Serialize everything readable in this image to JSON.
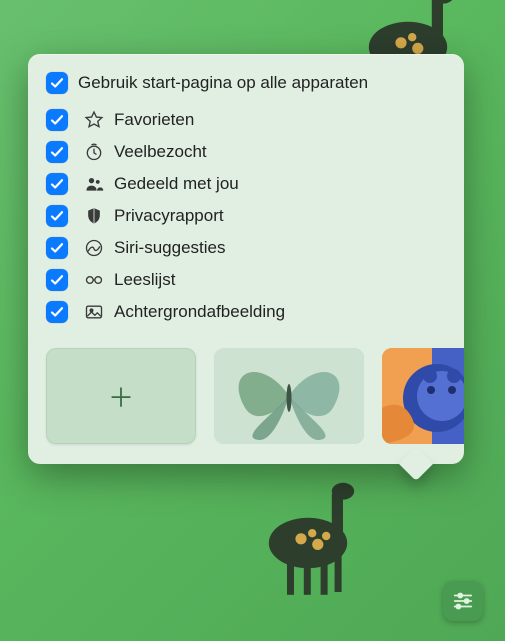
{
  "header": {
    "label": "Gebruik start-pagina op alle apparaten",
    "checked": true
  },
  "options": [
    {
      "id": "favorites",
      "label": "Favorieten",
      "icon": "star",
      "checked": true
    },
    {
      "id": "frequent",
      "label": "Veelbezocht",
      "icon": "clock",
      "checked": true
    },
    {
      "id": "shared",
      "label": "Gedeeld met jou",
      "icon": "people",
      "checked": true
    },
    {
      "id": "privacy",
      "label": "Privacyrapport",
      "icon": "shield",
      "checked": true
    },
    {
      "id": "siri",
      "label": "Siri-suggesties",
      "icon": "nosign",
      "checked": true
    },
    {
      "id": "readinglist",
      "label": "Leeslijst",
      "icon": "glasses",
      "checked": true
    },
    {
      "id": "background",
      "label": "Achtergrondafbeelding",
      "icon": "image",
      "checked": true
    }
  ],
  "thumbnails": [
    {
      "kind": "add"
    },
    {
      "kind": "butterfly"
    },
    {
      "kind": "art"
    }
  ],
  "settingsButton": "settings"
}
